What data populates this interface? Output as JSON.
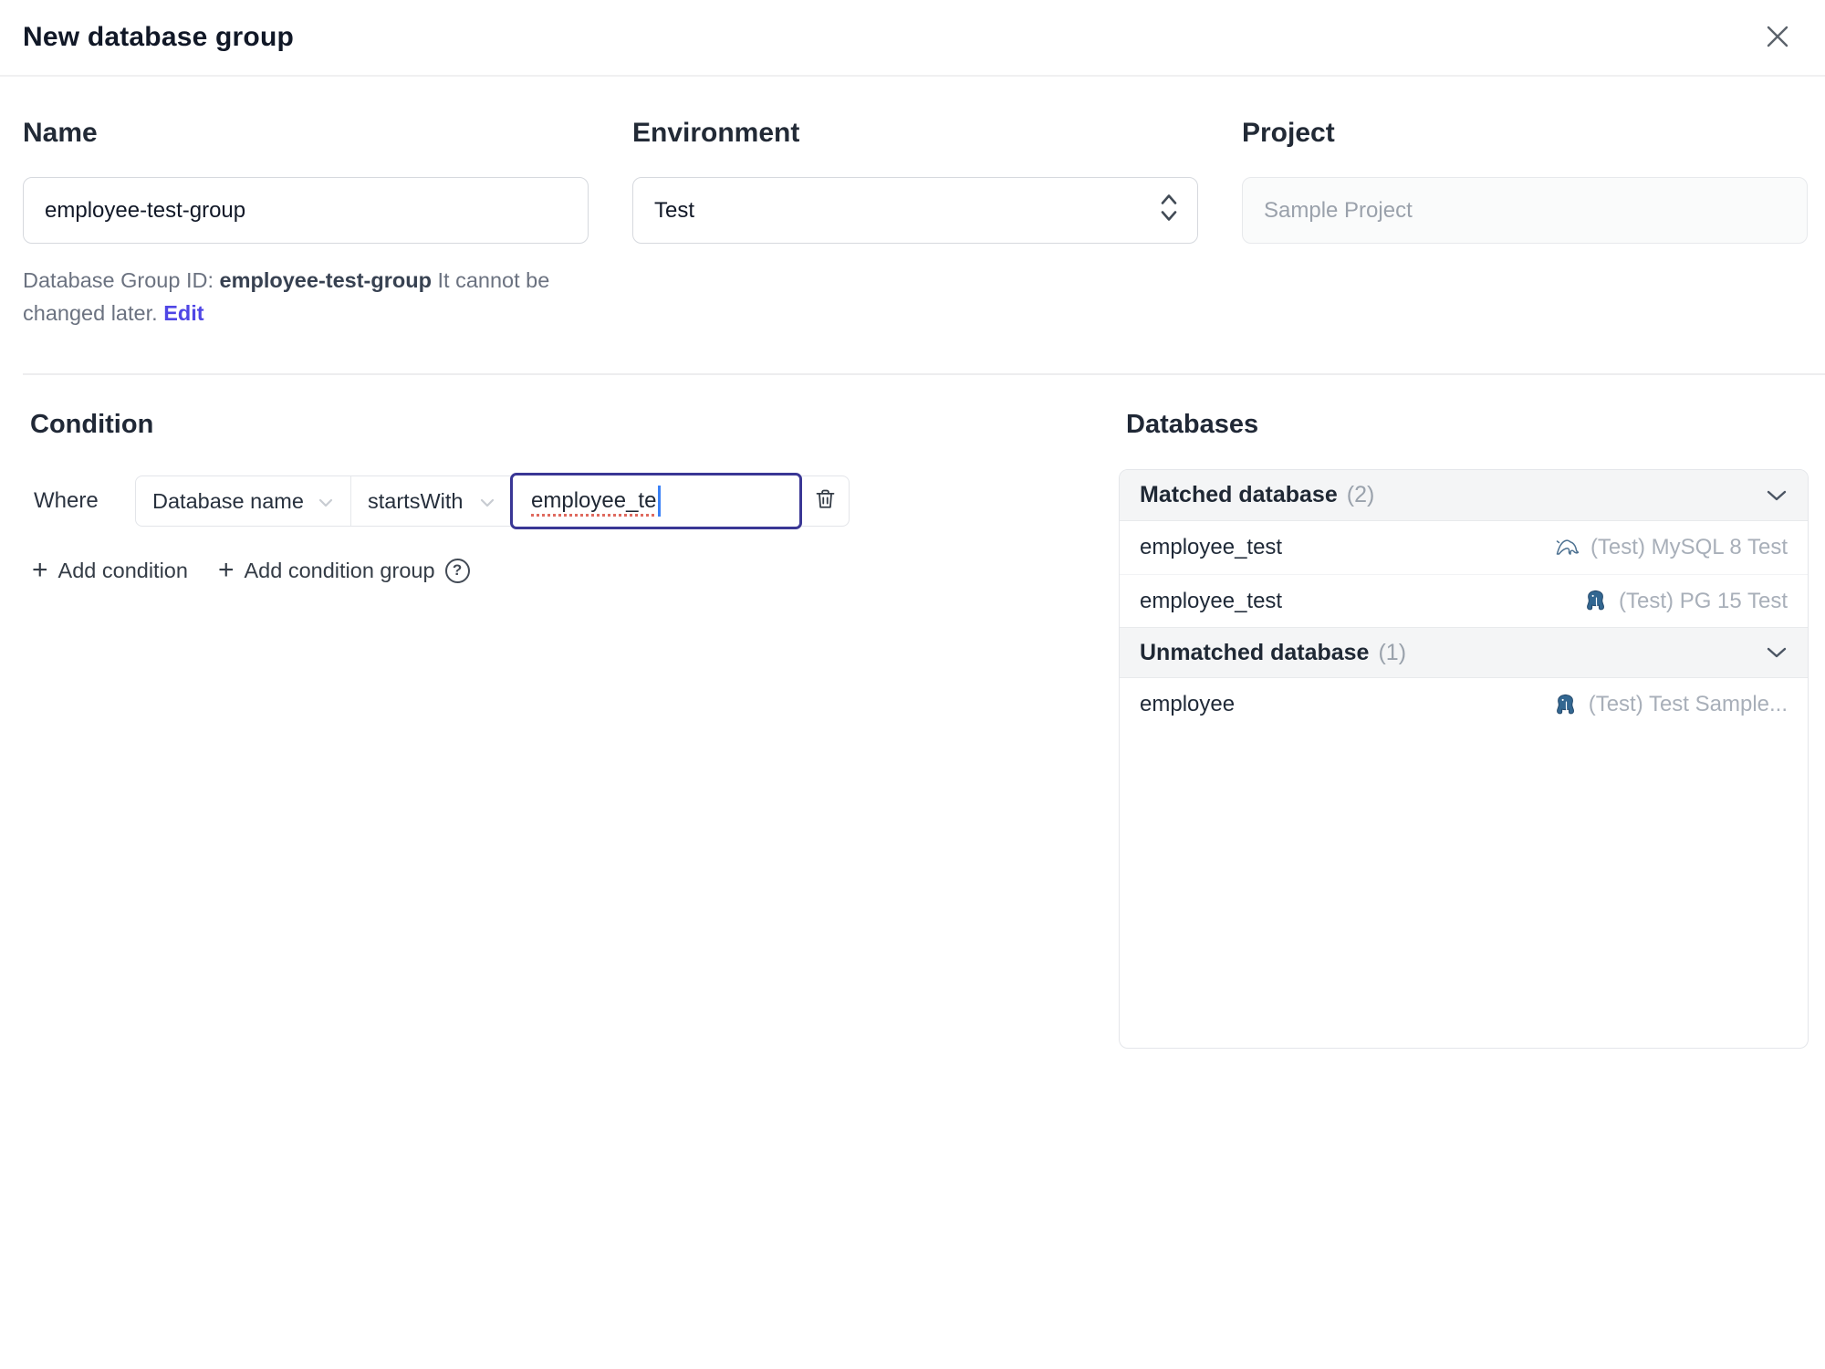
{
  "dialog": {
    "title": "New database group"
  },
  "form": {
    "name_label": "Name",
    "name_value": "employee-test-group",
    "environment_label": "Environment",
    "environment_value": "Test",
    "project_label": "Project",
    "project_value": "Sample Project",
    "group_id_prefix": "Database Group ID:",
    "group_id_value": "employee-test-group",
    "group_id_suffix": "It cannot be changed later.",
    "edit_link": "Edit"
  },
  "condition": {
    "heading": "Condition",
    "where_label": "Where",
    "factor": "Database name",
    "operator": "startsWith",
    "value": "employee_te",
    "add_condition": "Add condition",
    "add_condition_group": "Add condition group"
  },
  "databases": {
    "heading": "Databases",
    "matched_label": "Matched database",
    "matched_count": "(2)",
    "unmatched_label": "Unmatched database",
    "unmatched_count": "(1)",
    "matched_rows": [
      {
        "name": "employee_test",
        "engine": "mysql",
        "instance": "(Test) MySQL 8 Test"
      },
      {
        "name": "employee_test",
        "engine": "postgres",
        "instance": "(Test) PG 15 Test"
      }
    ],
    "unmatched_rows": [
      {
        "name": "employee",
        "engine": "postgres",
        "instance": "(Test) Test Sample..."
      }
    ]
  },
  "icons": {
    "plus": "+",
    "help": "?"
  },
  "colors": {
    "accent": "#4f46e5",
    "focus_border": "#3a3795",
    "caret": "#3b82f6",
    "spellcheck_underline": "#df6a5f",
    "mysql_blue": "#4d7191",
    "postgres_blue": "#336791",
    "header_bg": "#f4f5f6",
    "border": "#e4e6ea"
  }
}
